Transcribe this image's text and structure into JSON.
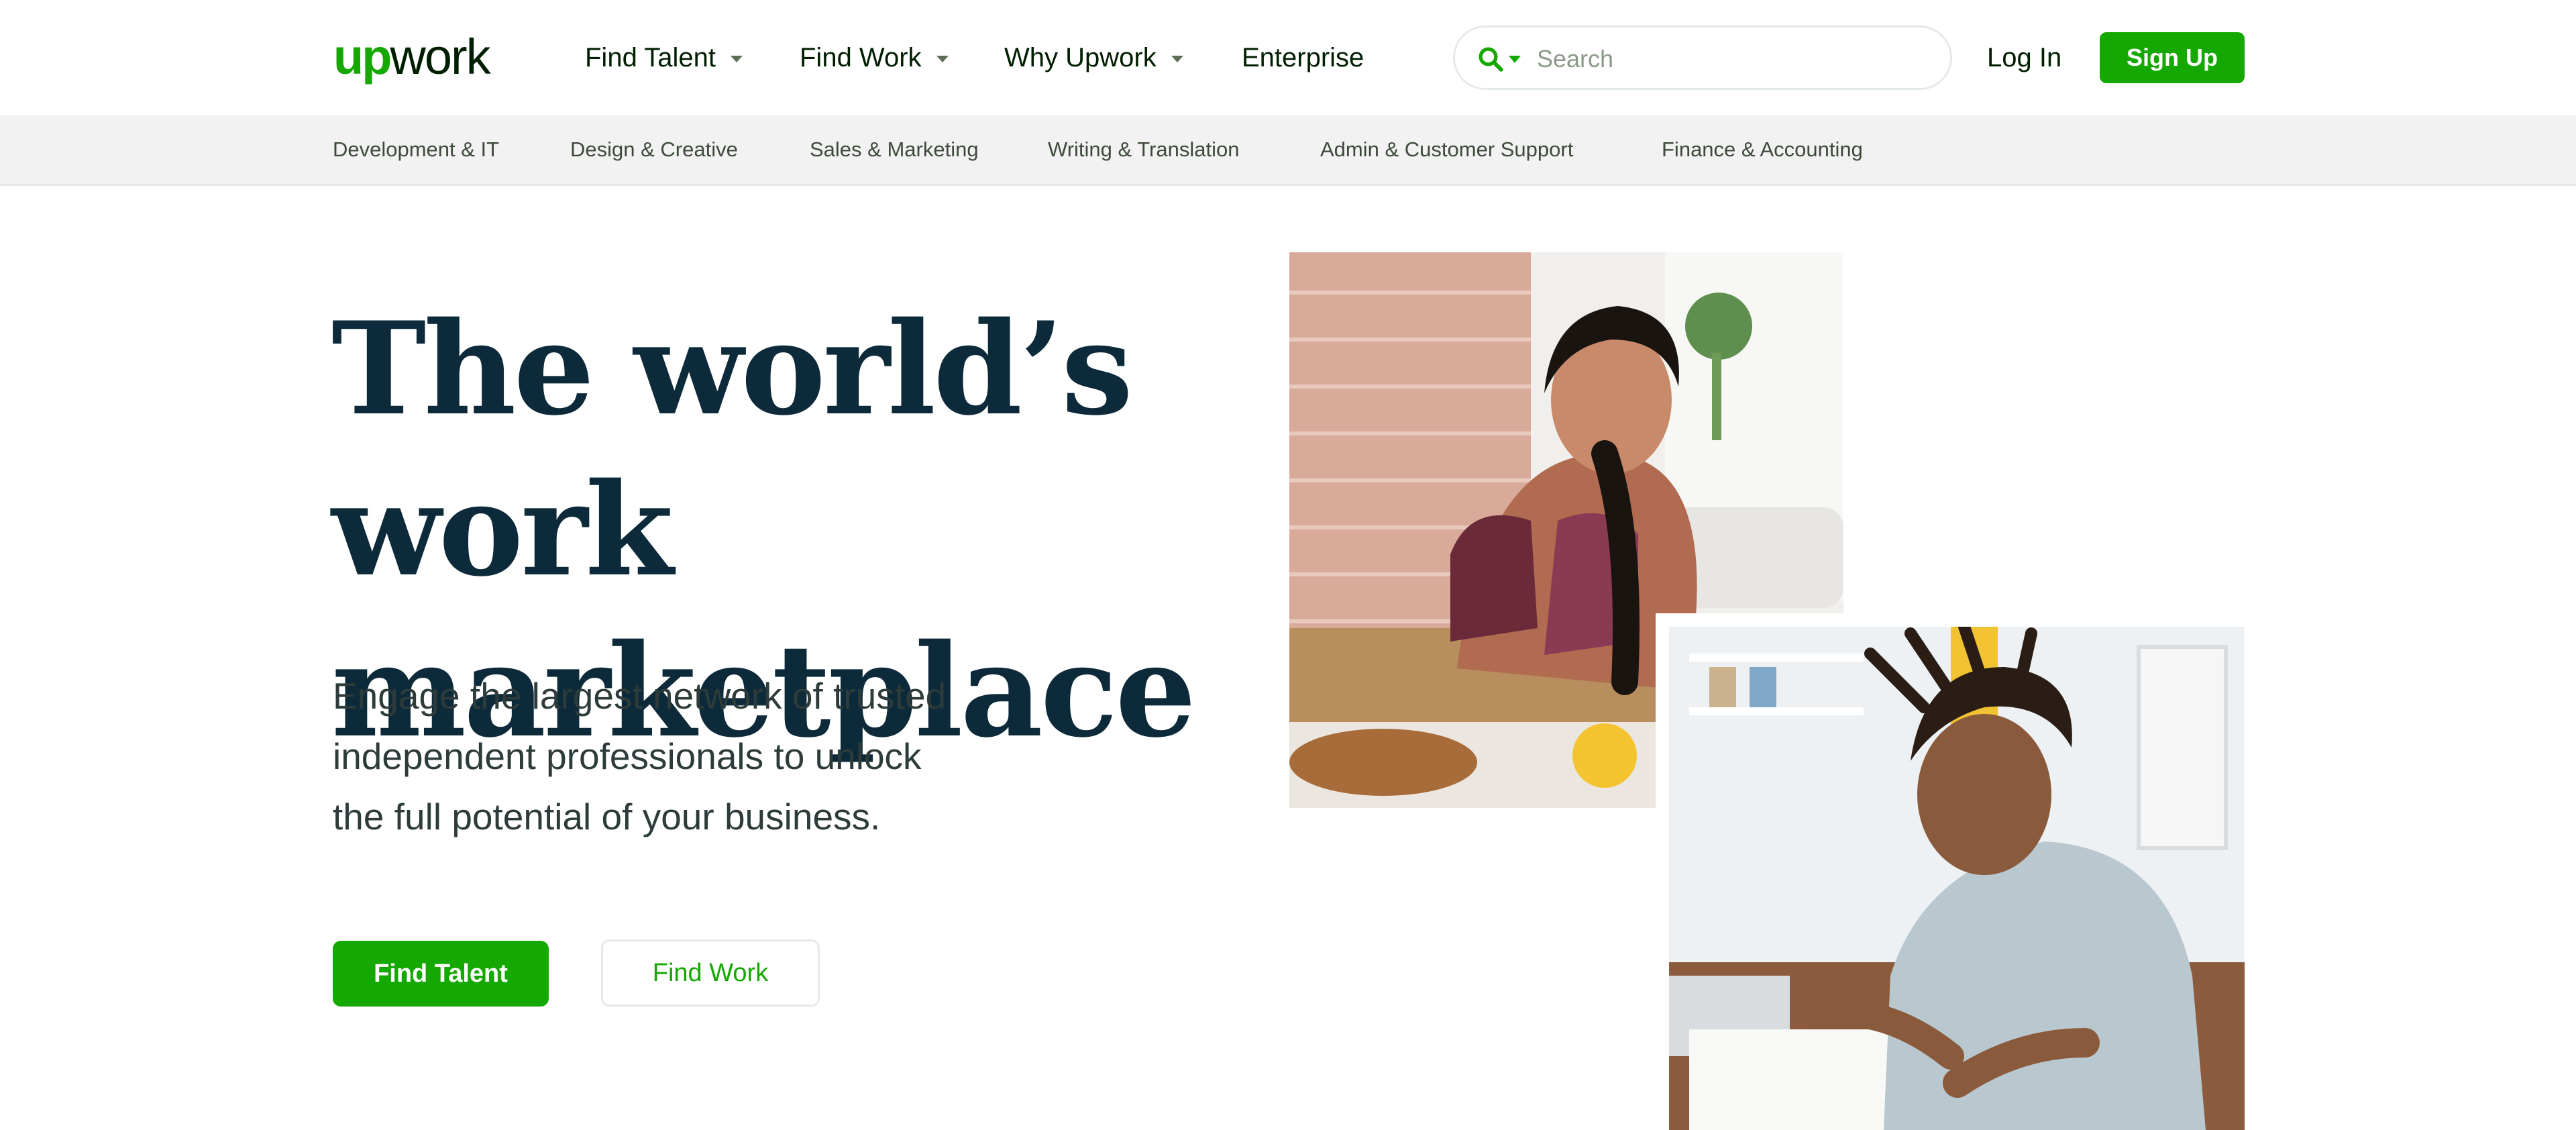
{
  "logo": {
    "up": "up",
    "work": "work"
  },
  "nav": {
    "items": [
      {
        "label": "Find Talent",
        "has_menu": true
      },
      {
        "label": "Find Work",
        "has_menu": true
      },
      {
        "label": "Why Upwork",
        "has_menu": true
      },
      {
        "label": "Enterprise",
        "has_menu": false
      }
    ],
    "login_label": "Log In",
    "signup_label": "Sign Up"
  },
  "search": {
    "placeholder": "Search",
    "value": "",
    "icon": "search-icon"
  },
  "categories": [
    "Development & IT",
    "Design & Creative",
    "Sales & Marketing",
    "Writing & Translation",
    "Admin & Customer Support",
    "Finance & Accounting"
  ],
  "hero": {
    "title_line1": "The world’s work",
    "title_line2": "marketplace",
    "subtitle_line1": "Engage the largest network of trusted",
    "subtitle_line2": "independent professionals to unlock",
    "subtitle_line3": "the full potential of your business.",
    "primary_button": "Find Talent",
    "secondary_button": "Find Work"
  },
  "colors": {
    "brand_green": "#14a800",
    "heading": "#0d2a3a",
    "category_bar": "#f2f2f2"
  }
}
